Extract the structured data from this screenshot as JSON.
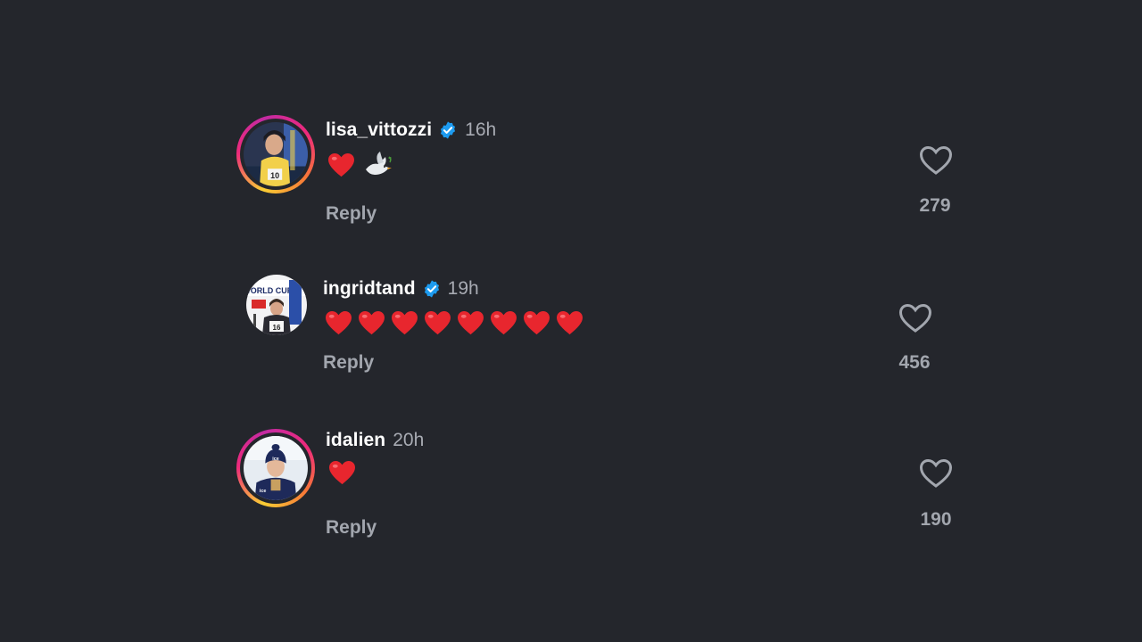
{
  "comments": [
    {
      "username": "lisa_vittozzi",
      "verified": true,
      "timestamp": "16h",
      "emojis": [
        "red-heart",
        "dove"
      ],
      "reply_label": "Reply",
      "like_count": "279"
    },
    {
      "username": "ingridtand",
      "verified": true,
      "timestamp": "19h",
      "emojis": [
        "red-heart",
        "red-heart",
        "red-heart",
        "red-heart",
        "red-heart",
        "red-heart",
        "red-heart",
        "red-heart"
      ],
      "reply_label": "Reply",
      "like_count": "456"
    },
    {
      "username": "idalien",
      "verified": false,
      "timestamp": "20h",
      "emojis": [
        "red-heart"
      ],
      "reply_label": "Reply",
      "like_count": "190"
    }
  ],
  "colors": {
    "background": "#24262c",
    "verified_badge": "#1d9bf0",
    "heart": "#e8262e",
    "secondary_text": "#a2a6ae"
  },
  "icons": {
    "like": "heart-outline-icon",
    "verified": "verified-badge-icon"
  }
}
